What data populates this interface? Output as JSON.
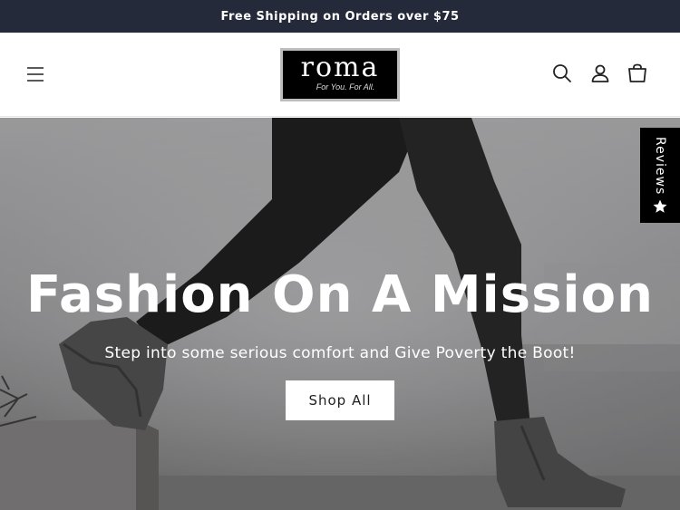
{
  "announcement": {
    "text": "Free Shipping on Orders over $75"
  },
  "header": {
    "logo_word": "roma",
    "logo_tagline": "For You. For All.",
    "icons": [
      "hamburger-menu-icon",
      "search-icon",
      "account-icon",
      "cart-icon"
    ]
  },
  "hero": {
    "title": "Fashion On A Mission",
    "subtitle": "Step into some serious comfort and Give Poverty the Boot!",
    "cta_label": "Shop All"
  },
  "reviews_tab": {
    "label": "Reviews",
    "icon": "star-icon"
  },
  "colors": {
    "announcement_bg": "#252a3a",
    "header_bg": "#ffffff",
    "cta_bg": "#ffffff",
    "reviews_bg": "#000000"
  }
}
